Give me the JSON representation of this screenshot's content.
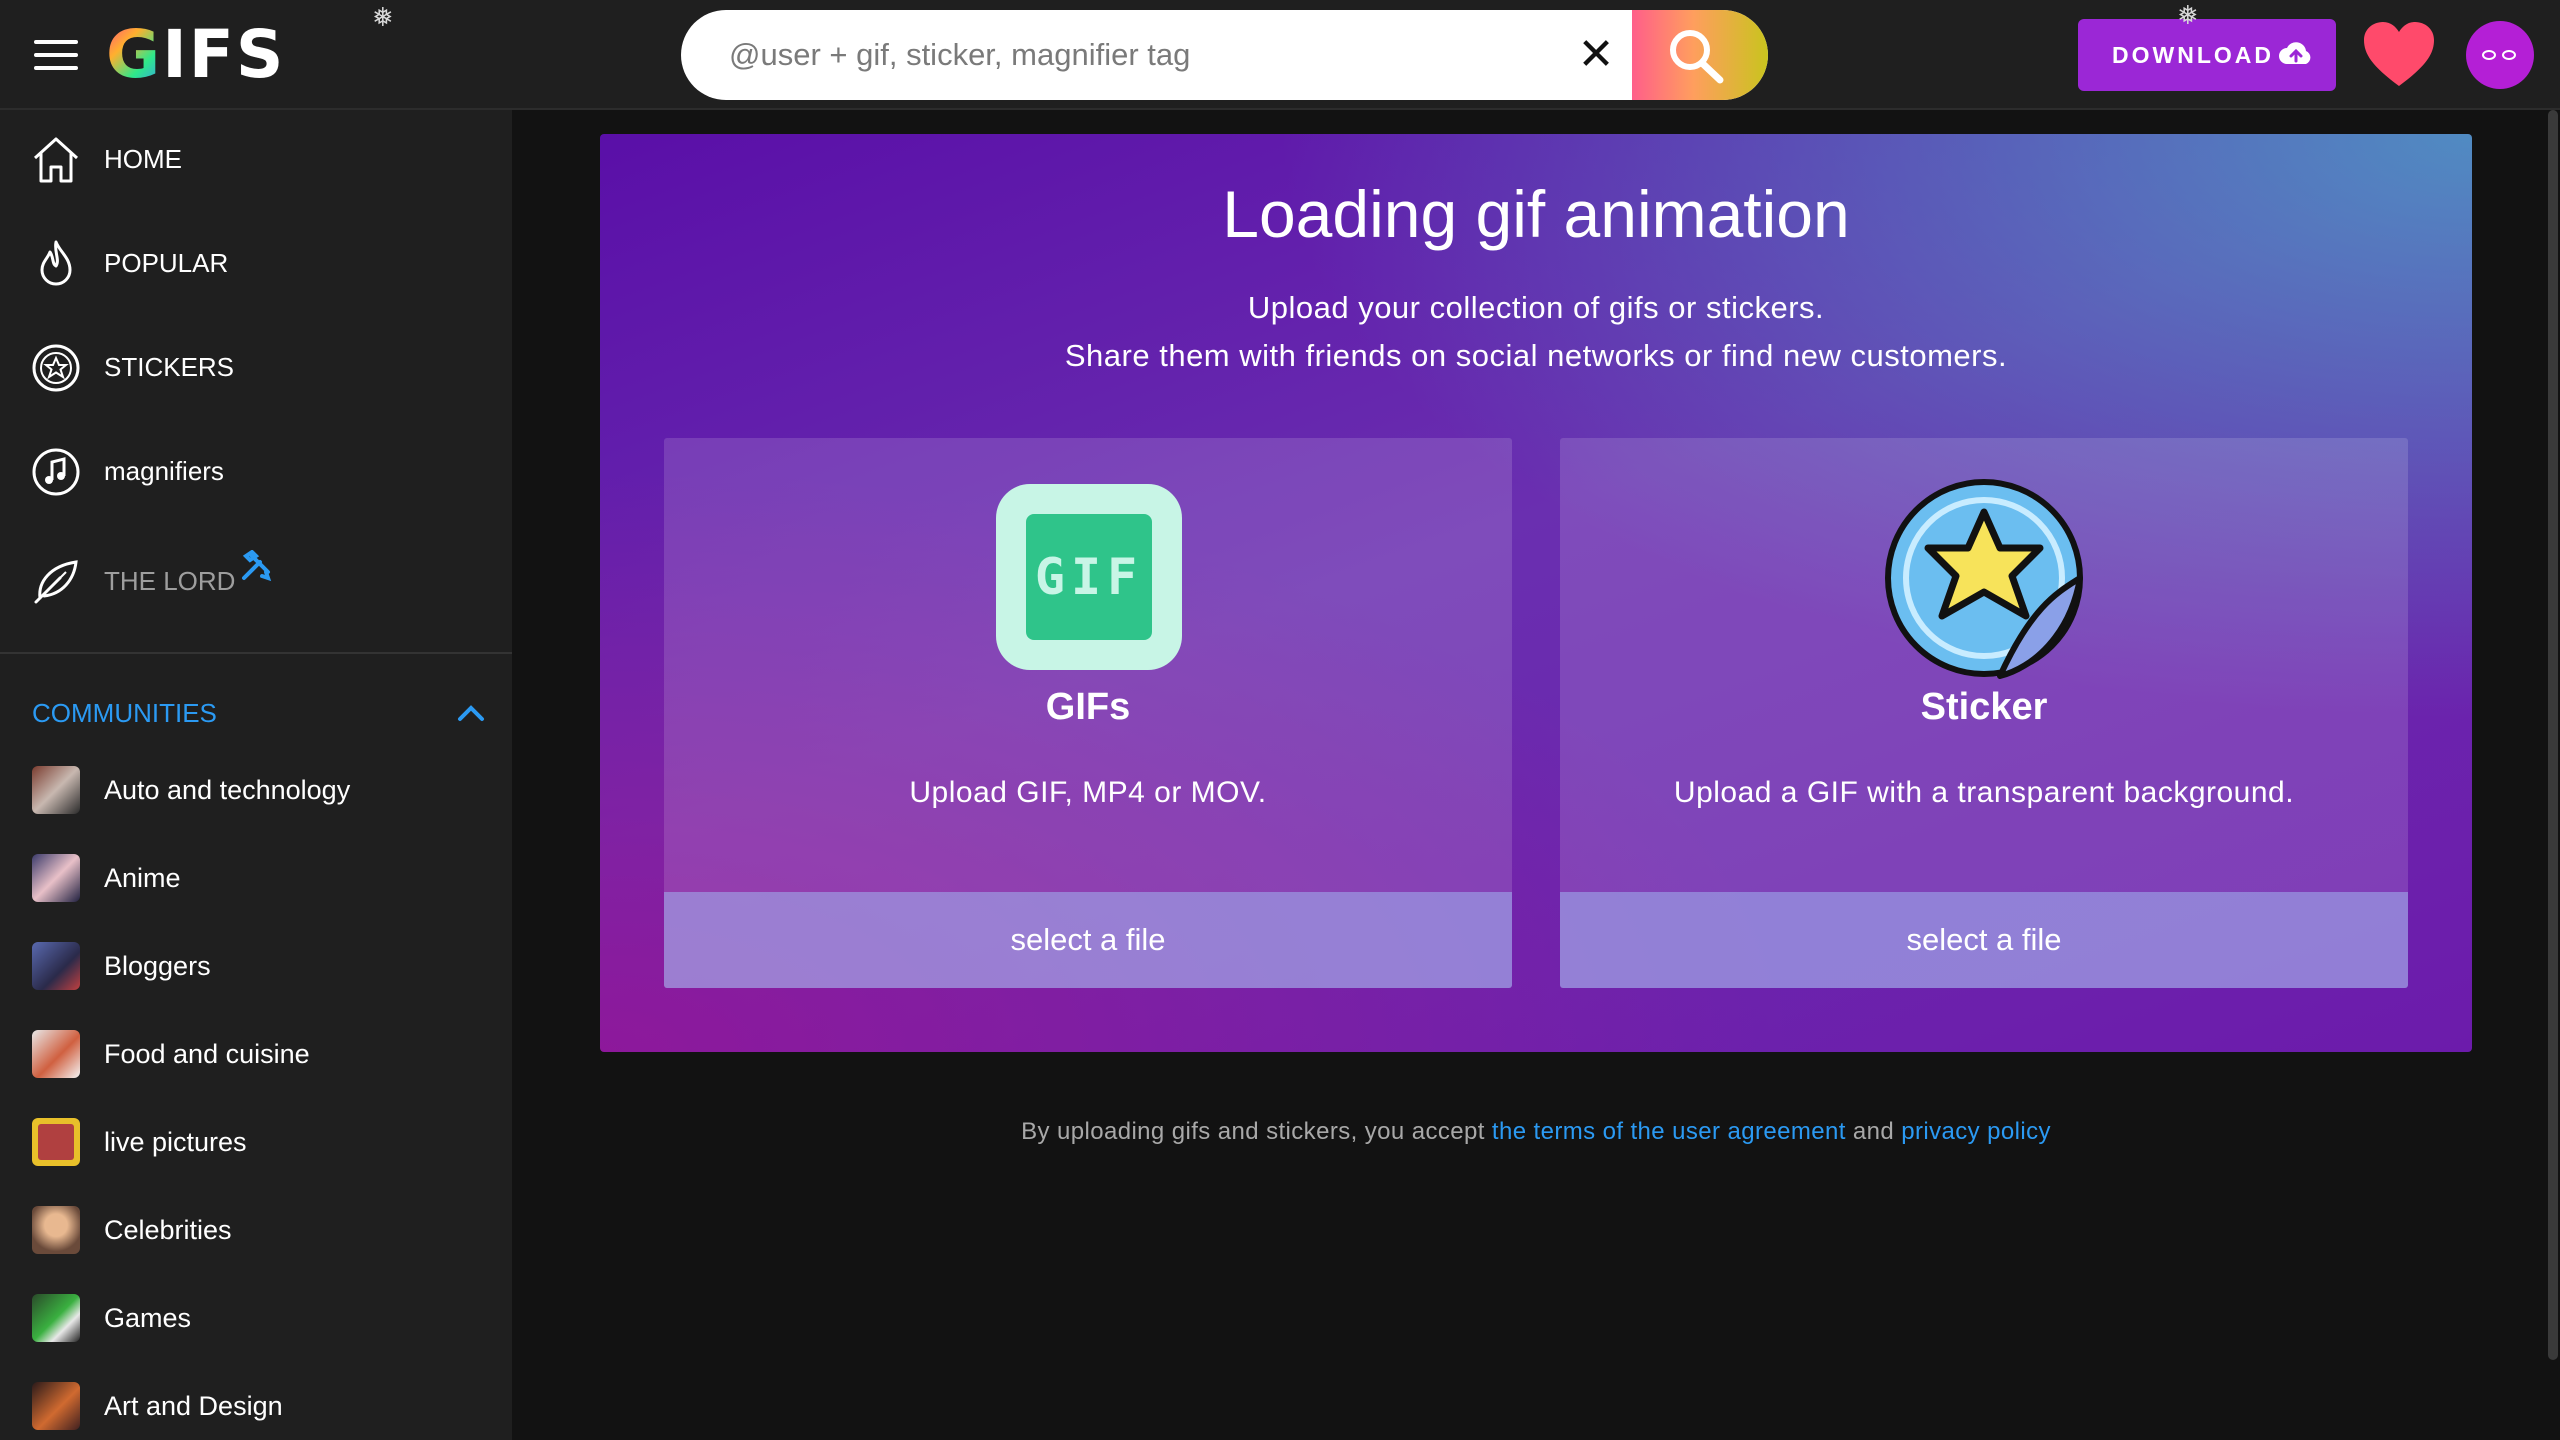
{
  "header": {
    "logo_text": "GIFS",
    "search_placeholder": "@user + gif, sticker, magnifier tag",
    "clear_symbol": "✕",
    "download_label": "DOWNLOAD",
    "snow_symbol": "❅"
  },
  "sidebar": {
    "nav": [
      {
        "label": "HOME",
        "icon": "home-icon"
      },
      {
        "label": "POPULAR",
        "icon": "flame-icon"
      },
      {
        "label": "STICKERS",
        "icon": "sticker-star-icon"
      },
      {
        "label": "magnifiers",
        "icon": "music-note-icon"
      },
      {
        "label": "THE LORD",
        "icon": "feather-quill-icon"
      }
    ],
    "communities_label": "COMMUNITIES",
    "communities": [
      {
        "label": "Auto and technology"
      },
      {
        "label": "Anime"
      },
      {
        "label": "Bloggers"
      },
      {
        "label": "Food and cuisine"
      },
      {
        "label": "live pictures"
      },
      {
        "label": "Celebrities"
      },
      {
        "label": "Games"
      },
      {
        "label": "Art and Design"
      }
    ]
  },
  "main": {
    "title": "Loading gif animation",
    "subtitle_line1": "Upload your collection of gifs or stickers.",
    "subtitle_line2": "Share them with friends on social networks or find new customers.",
    "cards": [
      {
        "title": "GIFs",
        "description": "Upload GIF, MP4 or MOV.",
        "button": "select a file",
        "icon_text": "GIF"
      },
      {
        "title": "Sticker",
        "description": "Upload a GIF with a transparent background.",
        "button": "select a file"
      }
    ],
    "footer": {
      "prefix": "By uploading gifs and stickers, you accept",
      "terms_link": "the terms of the user agreement",
      "and": "and",
      "privacy_link": "privacy policy"
    }
  },
  "colors": {
    "accent_blue": "#2b9af3",
    "download_purple": "#9b27d6",
    "heart": "#ff4a6b",
    "avatar": "#b41fd6"
  }
}
